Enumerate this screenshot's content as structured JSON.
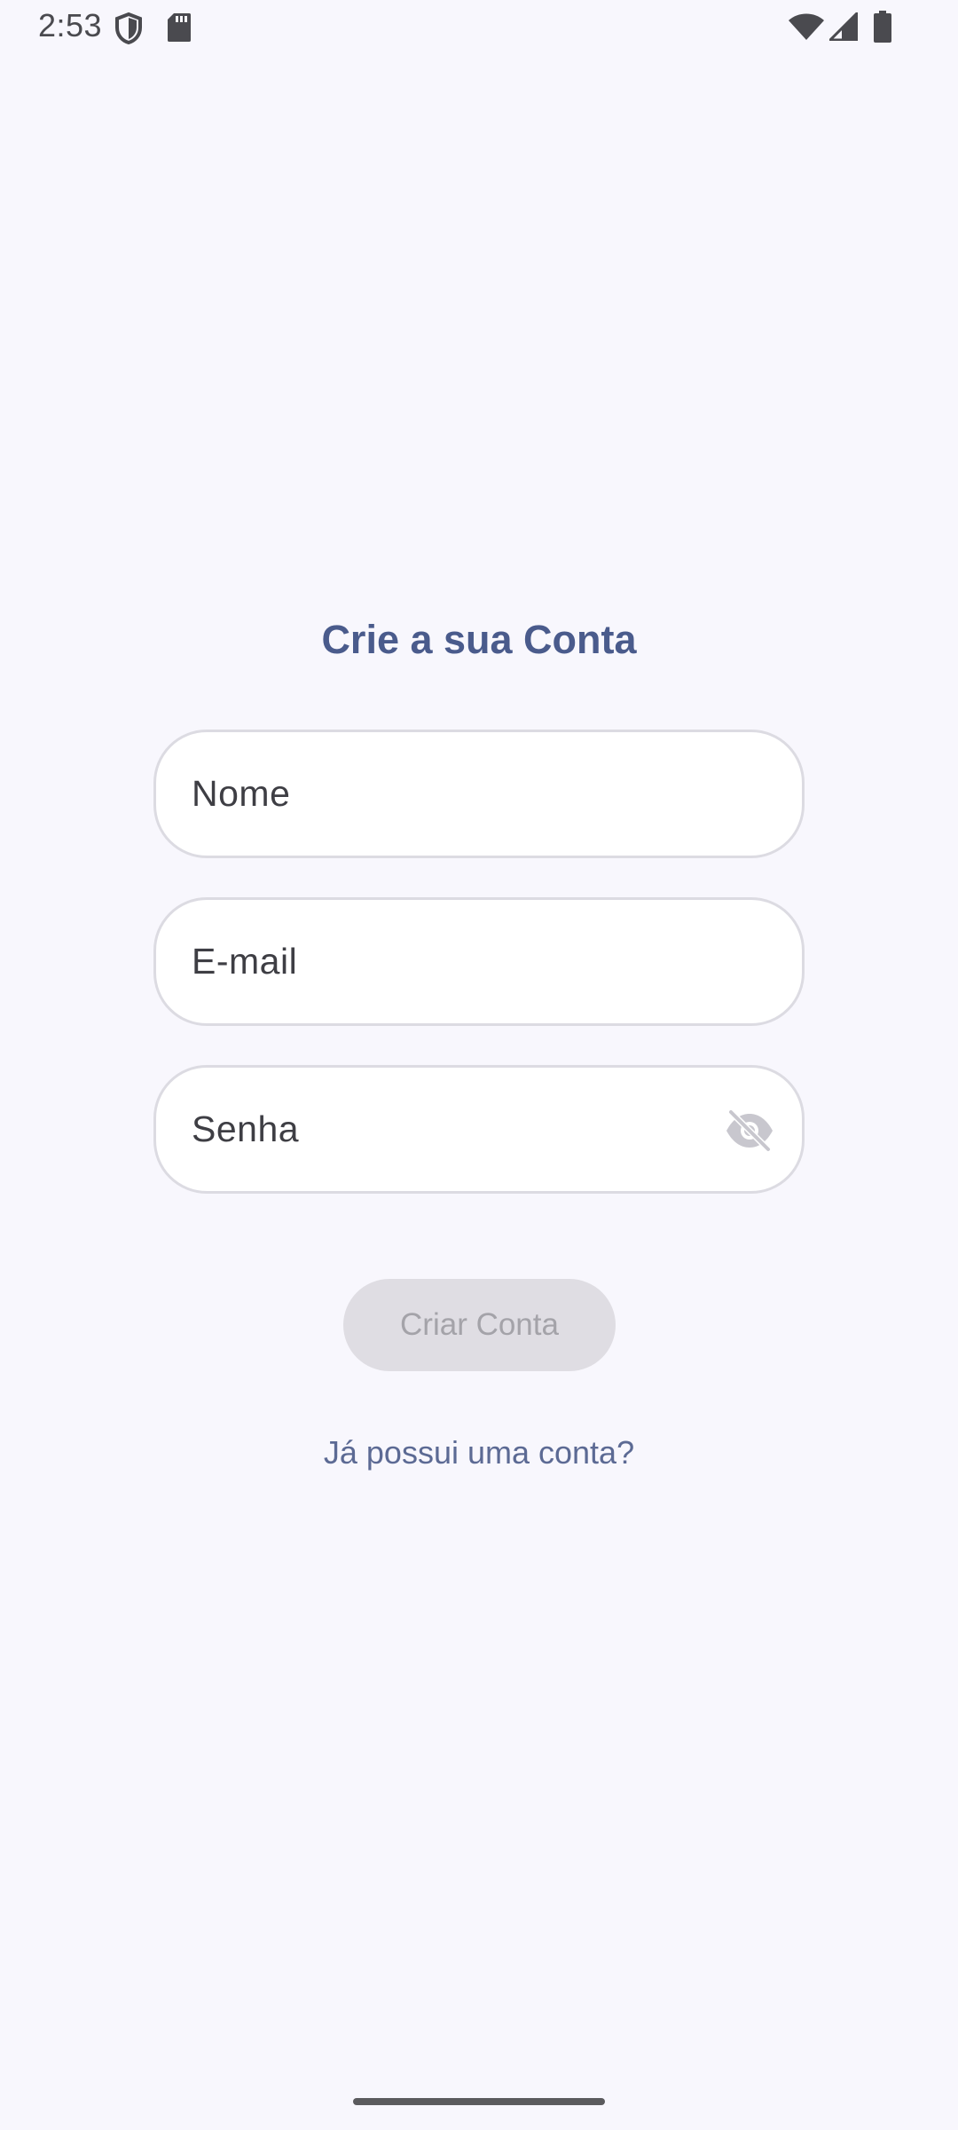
{
  "status_bar": {
    "time": "2:53",
    "icons": [
      "shield-icon",
      "sd-card-icon",
      "wifi-icon",
      "signal-icon",
      "battery-icon"
    ]
  },
  "screen": {
    "title": "Crie a sua Conta",
    "fields": {
      "name": {
        "placeholder": "Nome",
        "value": ""
      },
      "email": {
        "placeholder": "E-mail",
        "value": ""
      },
      "password": {
        "placeholder": "Senha",
        "value": "",
        "visibility_icon": "visibility-off-icon"
      }
    },
    "create_button": {
      "label": "Criar Conta",
      "enabled": false
    },
    "login_link": "Já possui uma conta?"
  },
  "colors": {
    "background": "#f8f7fd",
    "title": "#4a5b8c",
    "link": "#5c6a94",
    "button_disabled_bg": "#dfdde3",
    "button_disabled_text": "#a4a3a9"
  }
}
